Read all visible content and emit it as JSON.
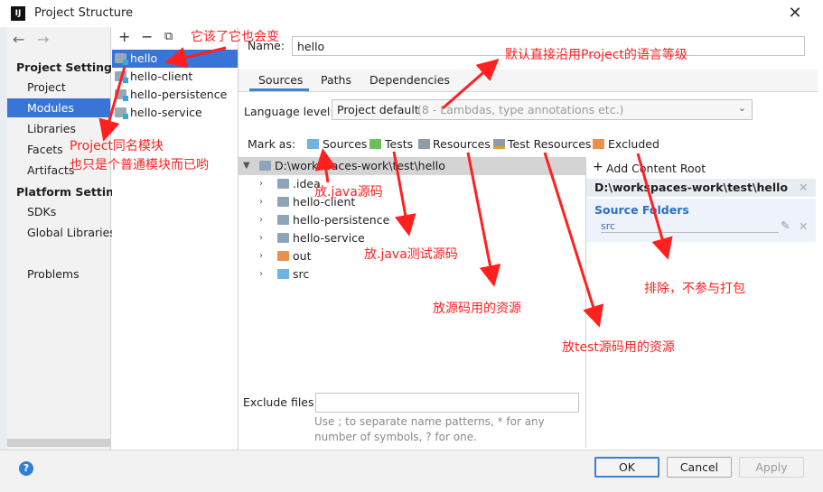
{
  "window": {
    "title": "Project Structure",
    "logo": "IJ"
  },
  "left_nav": {
    "project_settings_title": "Project Settings",
    "project_settings_items": [
      "Project",
      "Modules",
      "Libraries",
      "Facets",
      "Artifacts"
    ],
    "platform_settings_title": "Platform Settings",
    "platform_settings_items": [
      "SDKs",
      "Global Libraries"
    ],
    "other_items": [
      "Problems"
    ],
    "selected": "Modules"
  },
  "modules": {
    "items": [
      "hello",
      "hello-client",
      "hello-persistence",
      "hello-service"
    ],
    "selected": "hello"
  },
  "details": {
    "name_label": "Name:",
    "name_value": "hello",
    "tabs": [
      "Sources",
      "Paths",
      "Dependencies"
    ],
    "active_tab": "Sources",
    "language_label": "Language level:",
    "language_value": "Project default",
    "language_hint": "(8 - Lambdas, type annotations etc.)",
    "mark_as_label": "Mark as:",
    "mark_as_items": [
      {
        "label": "Sources",
        "color": "#6fb3e0"
      },
      {
        "label": "Tests",
        "color": "#6bbf59"
      },
      {
        "label": "Resources",
        "color": "#8f9aa6"
      },
      {
        "label": "Test Resources",
        "color": "#8f9aa6"
      },
      {
        "label": "Excluded",
        "color": "#e8914f"
      }
    ],
    "tree_root": "D:\\workspaces-work\\test\\hello",
    "tree_items": [
      ".idea",
      "hello-client",
      "hello-persistence",
      "hello-service",
      "out",
      "src"
    ],
    "exclude_label": "Exclude files:",
    "exclude_value": "",
    "exclude_hint": "Use ; to separate name patterns, * for any number of symbols, ? for one.",
    "content_root": {
      "add_label": "Add Content Root",
      "path": "D:\\workspaces-work\\test\\hello",
      "source_folders_title": "Source Folders",
      "source_folder": "src"
    }
  },
  "buttons": {
    "ok": "OK",
    "cancel": "Cancel",
    "apply": "Apply",
    "help": "?"
  },
  "annotations": {
    "module_name_changes": "它该了它也会变",
    "same_name_module_1": "Project同名模块",
    "same_name_module_2": "也只是个普通模块而已哟",
    "language_default": "默认直接沿用Project的语言等级",
    "java_source": "放.java源码",
    "java_test_source": "放.java测试源码",
    "source_resources": "放源码用的资源",
    "test_resources": "放test源码用的资源",
    "excluded": "排除，不参与打包"
  },
  "colors": {
    "selection": "#3875d6",
    "annotation": "#ff2020",
    "accent": "#4083c9"
  }
}
